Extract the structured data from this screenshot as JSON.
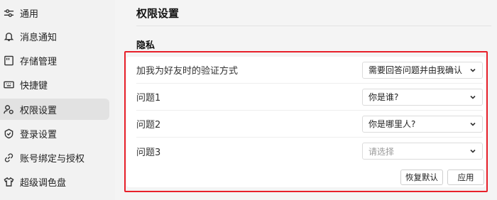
{
  "sidebar": {
    "items": [
      {
        "label": "通用",
        "icon": "sliders-icon",
        "active": false
      },
      {
        "label": "消息通知",
        "icon": "bell-icon",
        "active": false
      },
      {
        "label": "存储管理",
        "icon": "storage-icon",
        "active": false
      },
      {
        "label": "快捷键",
        "icon": "keyboard-icon",
        "active": false
      },
      {
        "label": "权限设置",
        "icon": "user-permission-icon",
        "active": true
      },
      {
        "label": "登录设置",
        "icon": "shield-icon",
        "active": false
      },
      {
        "label": "账号绑定与授权",
        "icon": "link-icon",
        "active": false
      },
      {
        "label": "超级调色盘",
        "icon": "tshirt-icon",
        "active": false
      }
    ]
  },
  "main": {
    "title": "权限设置",
    "section_title": "隐私",
    "rows": [
      {
        "label": "加我为好友时的验证方式",
        "value": "需要回答问题并由我确认",
        "placeholder": false
      },
      {
        "label": "问题1",
        "value": "你是谁?",
        "placeholder": false
      },
      {
        "label": "问题2",
        "value": "你是哪里人?",
        "placeholder": false
      },
      {
        "label": "问题3",
        "value": "请选择",
        "placeholder": true
      }
    ],
    "reset_label": "恢复默认",
    "apply_label": "应用"
  },
  "colors": {
    "highlight_border": "#e8202a",
    "active_nav_bg": "#e2e2e2"
  }
}
